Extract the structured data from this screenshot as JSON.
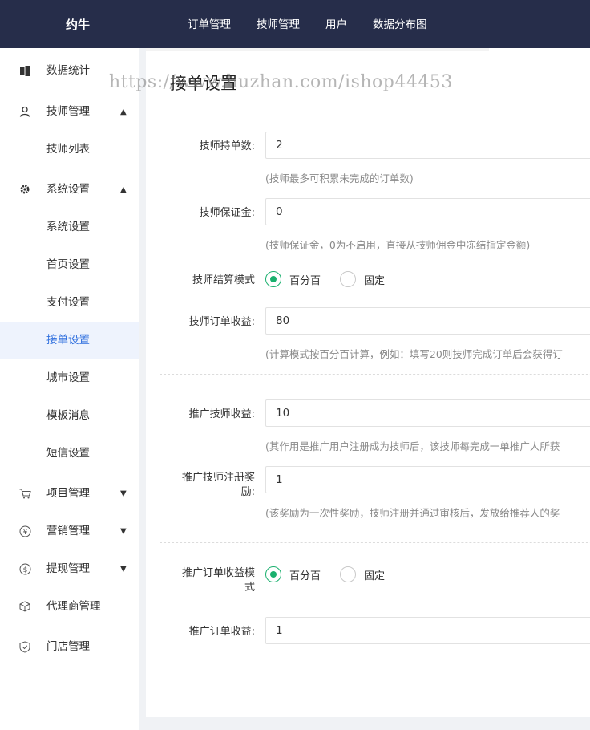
{
  "brand": "约牛",
  "topnav": [
    "订单管理",
    "技师管理",
    "用户",
    "数据分布图"
  ],
  "sidebar": [
    {
      "label": "数据统计",
      "icon": "windows-icon"
    },
    {
      "label": "技师管理",
      "icon": "user-icon",
      "arrow": "▲"
    },
    {
      "label": "技师列表",
      "sub": true
    },
    {
      "label": "系统设置",
      "icon": "gear-icon",
      "arrow": "▲"
    },
    {
      "label": "系统设置",
      "sub": true
    },
    {
      "label": "首页设置",
      "sub": true
    },
    {
      "label": "支付设置",
      "sub": true
    },
    {
      "label": "接单设置",
      "sub": true,
      "active": true
    },
    {
      "label": "城市设置",
      "sub": true
    },
    {
      "label": "模板消息",
      "sub": true
    },
    {
      "label": "短信设置",
      "sub": true
    },
    {
      "label": "项目管理",
      "icon": "cart-icon",
      "arrow": "▼"
    },
    {
      "label": "营销管理",
      "icon": "yen-icon",
      "arrow": "▼"
    },
    {
      "label": "提现管理",
      "icon": "dollar-icon",
      "arrow": "▼"
    },
    {
      "label": "代理商管理",
      "icon": "cube-icon"
    },
    {
      "label": "门店管理",
      "icon": "shield-icon"
    }
  ],
  "page": {
    "title": "接单设置",
    "watermark": "https://www.huzhan.com/ishop44453"
  },
  "form": {
    "max_orders": {
      "label": "技师持单数:",
      "value": "2",
      "hint": "(技师最多可积累未完成的订单数)"
    },
    "deposit": {
      "label": "技师保证金:",
      "value": "0",
      "hint": "(技师保证金，0为不启用，直接从技师佣金中冻结指定金额)"
    },
    "settle_mode": {
      "label": "技师结算模式",
      "options": [
        "百分百",
        "固定"
      ],
      "selected": "百分百"
    },
    "order_income": {
      "label": "技师订单收益:",
      "value": "80",
      "hint": "(计算模式按百分百计算，例如：填写20则技师完成订单后会获得订"
    },
    "promo_income": {
      "label": "推广技师收益:",
      "value": "10",
      "hint": "(其作用是推广用户注册成为技师后，该技师每完成一单推广人所获"
    },
    "register_reward": {
      "label": "推广技师注册奖励:",
      "label_line1": "推广技师注册奖",
      "label_line2": "励:",
      "value": "1",
      "hint": "(该奖励为一次性奖励，技师注册并通过审核后，发放给推荐人的奖"
    },
    "promo_order_mode": {
      "label_line1": "推广订单收益模",
      "label_line2": "式",
      "options": [
        "百分百",
        "固定"
      ],
      "selected": "百分百"
    },
    "promo_order_income": {
      "label": "推广订单收益:",
      "value": "1"
    }
  },
  "colors": {
    "navbar": "#262d4a",
    "accent": "#2f6fde",
    "radio": "#1ab06e"
  }
}
